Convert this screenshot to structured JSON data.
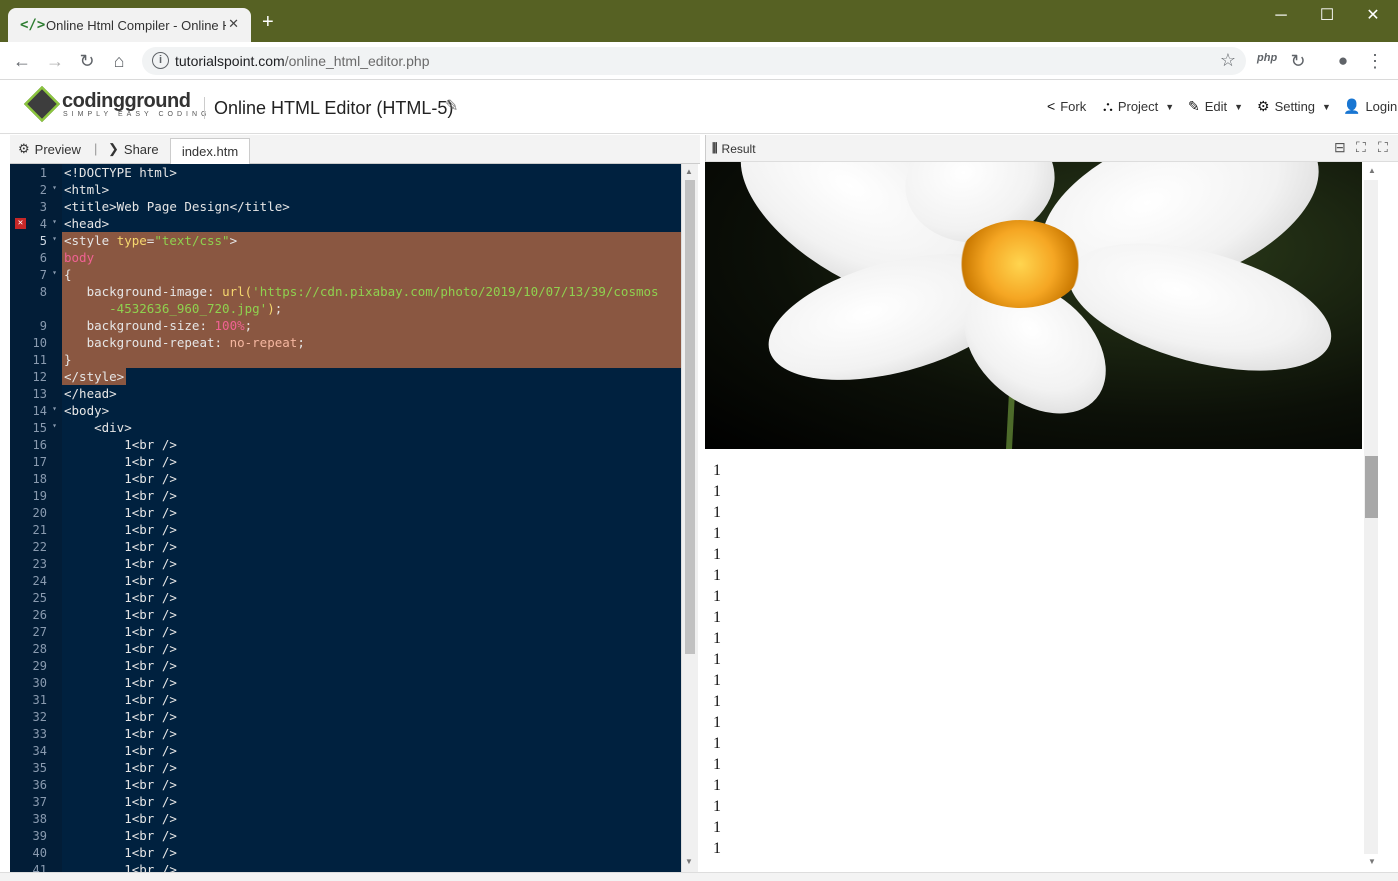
{
  "browser": {
    "tab_title": "Online Html Compiler - Online H",
    "tab_close": "✕",
    "new_tab": "+",
    "url_host": "tutorialspoint.com",
    "url_path": "/online_html_editor.php",
    "ext_php": "php",
    "window_controls": {
      "minimize": "─",
      "maximize": "☐",
      "close": "✕"
    }
  },
  "site": {
    "logo_name": "codingground",
    "logo_tagline": "SIMPLY EASY CODING",
    "editor_title": "Online HTML Editor (HTML-5)",
    "menu": [
      {
        "label": "Fork",
        "icon": "share-icon"
      },
      {
        "label": "Project",
        "icon": "sitemap-icon"
      },
      {
        "label": "Edit",
        "icon": "edit-icon"
      },
      {
        "label": "Setting",
        "icon": "gear-icon"
      },
      {
        "label": "Login",
        "icon": "user-icon"
      }
    ]
  },
  "editor": {
    "tabs": {
      "preview": "Preview",
      "share": "Share",
      "file": "index.htm"
    },
    "error_line": 4,
    "lines": [
      "<!DOCTYPE html>",
      "<html>",
      "<title>Web Page Design</title>",
      "<head>",
      "<style type=\"text/css\">",
      "body",
      "{",
      "   background-image: url('https://cdn.pixabay.com/photo/2019/10/07/13/39/cosmos",
      "      -4532636_960_720.jpg');",
      "   background-size: 100%;",
      "   background-repeat: no-repeat;",
      "}",
      "</style>",
      "</head>",
      "<body>",
      "    <div>",
      "        1<br />"
    ],
    "line_numbers": [
      "1",
      "2",
      "3",
      "4",
      "5",
      "6",
      "7",
      "8",
      "",
      "9",
      "10",
      "11",
      "12",
      "13",
      "14",
      "15",
      "16",
      "17",
      "18",
      "19",
      "20",
      "21",
      "22",
      "23",
      "24",
      "25",
      "26",
      "27",
      "28",
      "29",
      "30",
      "31",
      "32",
      "33",
      "34",
      "35",
      "36",
      "37",
      "38",
      "39",
      "40",
      "41"
    ]
  },
  "result": {
    "label": "Result",
    "ones_count": 19,
    "digit": "1"
  }
}
